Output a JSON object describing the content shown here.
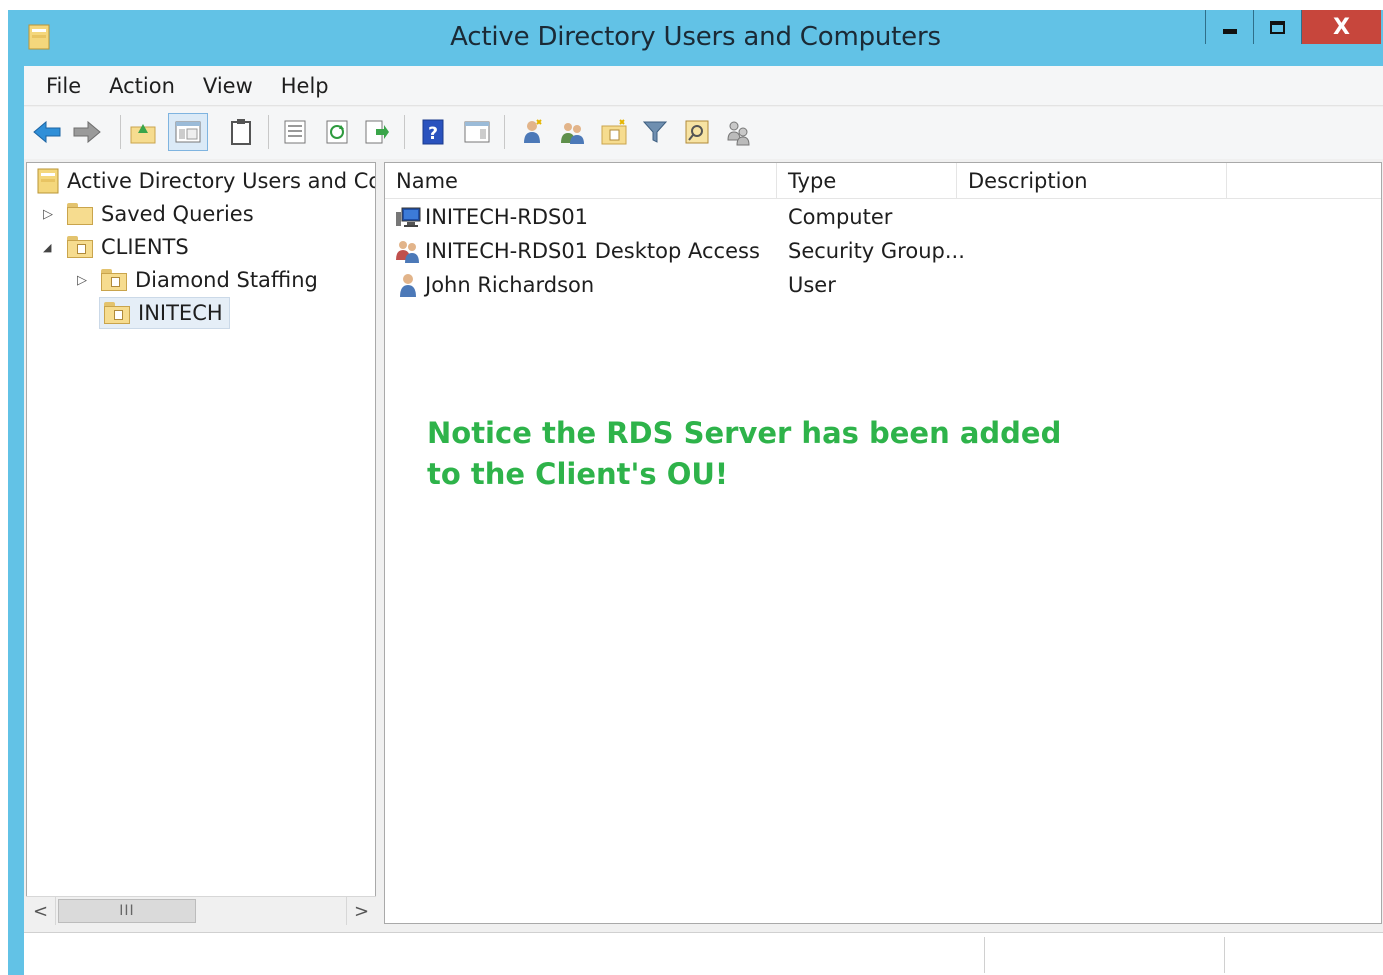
{
  "window": {
    "title": "Active Directory Users and Computers",
    "close_label": "X"
  },
  "menu": [
    "File",
    "Action",
    "View",
    "Help"
  ],
  "toolbar": {
    "buttons": [
      "back-icon",
      "forward-icon",
      "up-folder-icon",
      "show-hide-console-tree-icon",
      "clipboard-icon",
      "properties-icon",
      "refresh-icon",
      "export-list-icon",
      "help-icon",
      "action-pane-icon",
      "create-user-icon",
      "create-group-icon",
      "create-ou-icon",
      "filter-icon",
      "find-icon",
      "add-to-group-icon"
    ]
  },
  "tree": {
    "root": "Active Directory Users and Com",
    "items": [
      {
        "label": "Saved Queries",
        "expander": "▷"
      },
      {
        "label": "CLIENTS",
        "expander": "◢"
      },
      {
        "label": "Diamond Staffing",
        "expander": "▷"
      },
      {
        "label": "INITECH",
        "expander": ""
      }
    ],
    "scroll_thumb": "III"
  },
  "list": {
    "columns": [
      "Name",
      "Type",
      "Description"
    ],
    "rows": [
      {
        "name": "INITECH-RDS01",
        "type": "Computer",
        "icon": "computer-icon"
      },
      {
        "name": "INITECH-RDS01 Desktop Access",
        "type": "Security Group...",
        "icon": "group-icon"
      },
      {
        "name": "John Richardson",
        "type": "User",
        "icon": "user-icon"
      }
    ]
  },
  "annotation": {
    "line1": "Notice the RDS Server has been added",
    "line2": "to the Client's OU!",
    "color": "#2eb34a"
  },
  "colors": {
    "titlebar": "#62c2e6",
    "close_button": "#c7463c"
  }
}
